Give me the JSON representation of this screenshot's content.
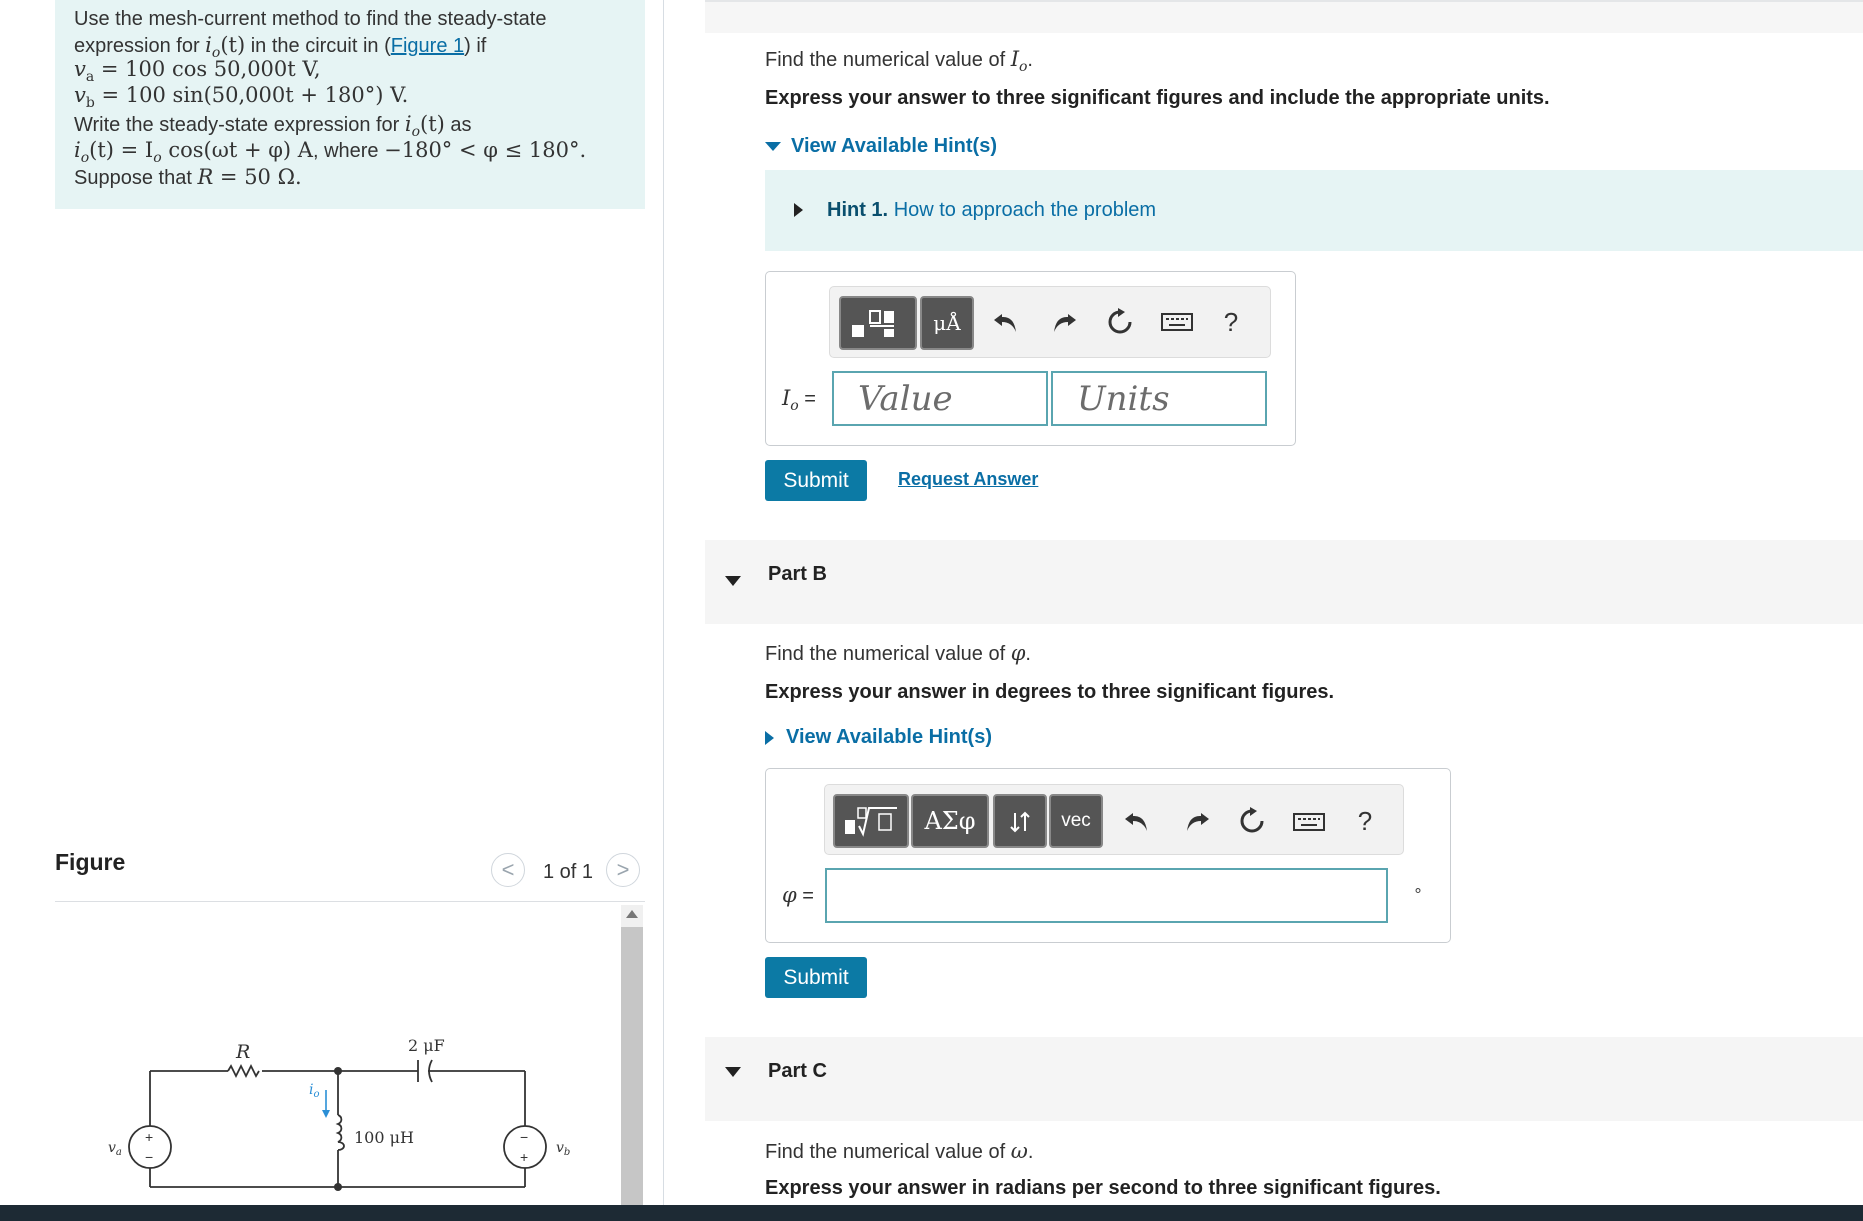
{
  "problem": {
    "line1": "Use the mesh-current method to find the steady-state",
    "line2_pre": "expression for ",
    "line2_io": "i",
    "line2_io_sub": "o",
    "line2_t": "(t)",
    "line2_mid": " in the circuit in (",
    "figure_link": "Figure 1",
    "line2_post": ") if",
    "va_sym": "v",
    "va_sub": "a",
    "va_expr": " = 100 cos 50,000t V,",
    "vb_sym": "v",
    "vb_sub": "b",
    "vb_expr": " = 100 sin(50,000t + 180°) V.",
    "line5_pre": "Write the steady-state expression for ",
    "line5_io": "i",
    "line5_io_sub": "o",
    "line5_t": "(t)",
    "line5_post": " as",
    "line6_lhs": "i",
    "line6_lhs_sub": "o",
    "line6_expr1": "(t) = I",
    "line6_expr_sub": "o",
    "line6_expr2": " cos(ωt + φ) A",
    "line6_where": ", where ",
    "line6_range": "−180° < φ ≤ 180°.",
    "line7_pre": "Suppose that ",
    "line7_R": "R",
    "line7_post": " = 50 Ω."
  },
  "figure_panel": {
    "heading": "Figure",
    "pager_text": "1 of 1",
    "prev_symbol": "<",
    "next_symbol": ">"
  },
  "circuit": {
    "R_label": "R",
    "C_label": "2 μF",
    "L_label": "100 μH",
    "io_label": "i",
    "io_sub": "o",
    "va_label": "v",
    "va_sub": "a",
    "vb_label": "v",
    "vb_sub": "b",
    "plus": "+",
    "minus": "−"
  },
  "part_a": {
    "question_pre": "Find the numerical value of ",
    "question_sym": "I",
    "question_sub": "o",
    "question_post": ".",
    "instruction": "Express your answer to three significant figures and include the appropriate units.",
    "hints_toggle": "View Available Hint(s)",
    "hint1_label": "Hint 1.",
    "hint1_text": "How to approach the problem",
    "toolbar_units_glyph": "μÅ",
    "help_symbol": "?",
    "answer_label_sym": "I",
    "answer_label_sub": "o",
    "answer_label_eq": " =",
    "value_placeholder": "Value",
    "units_placeholder": "Units",
    "submit": "Submit",
    "request_answer": "Request Answer"
  },
  "part_b": {
    "title": "Part B",
    "question_pre": "Find the numerical value of ",
    "question_sym": "φ",
    "question_post": ".",
    "instruction": "Express your answer in degrees to three significant figures.",
    "hints_toggle": "View Available Hint(s)",
    "greek_button": "ΑΣφ",
    "vec_button": "vec",
    "help_symbol": "?",
    "answer_label_sym": "φ",
    "answer_label_eq": " =",
    "unit_suffix": "∘",
    "submit": "Submit"
  },
  "part_c": {
    "title": "Part C",
    "question_pre": "Find the numerical value of ",
    "question_sym": "ω",
    "question_post": ".",
    "instruction": "Express your answer in radians per second to three significant figures."
  },
  "colors": {
    "accent": "#0c7aa5",
    "link": "#0a6ea5",
    "hint_bg": "#e6f4f4",
    "io_arrow": "#2b8fd6"
  },
  "icons": [
    "templates-icon",
    "units-icon",
    "undo-icon",
    "redo-icon",
    "reset-icon",
    "keyboard-icon",
    "help-icon",
    "sqrt-template-icon",
    "greek-icon",
    "arrows-icon",
    "vector-icon"
  ]
}
